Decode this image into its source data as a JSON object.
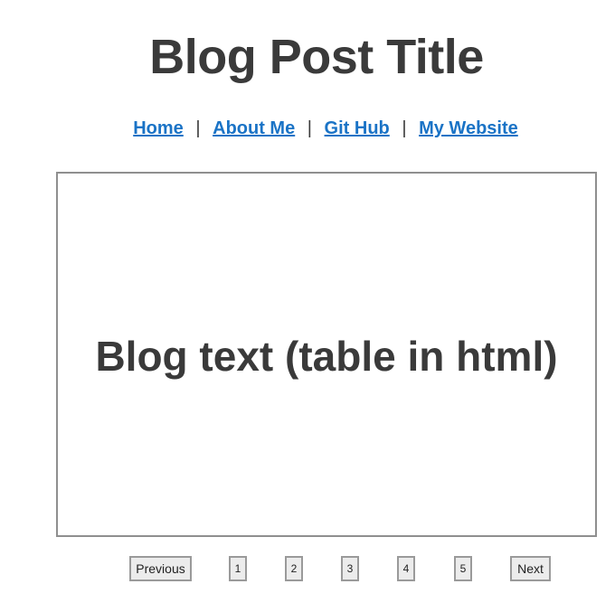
{
  "page": {
    "title": "Blog Post Title"
  },
  "nav": {
    "links": [
      "Home",
      "About Me",
      "Git Hub",
      "My Website"
    ],
    "separator": "|"
  },
  "content": {
    "text": "Blog text (table in html)"
  },
  "pagination": {
    "previous_label": "Previous",
    "next_label": "Next",
    "pages": [
      "1",
      "2",
      "3",
      "4",
      "5"
    ]
  },
  "colors": {
    "text": "#3a3a3a",
    "link": "#1a73c6",
    "border": "#8f8f8f",
    "button_bg": "#ececec"
  }
}
